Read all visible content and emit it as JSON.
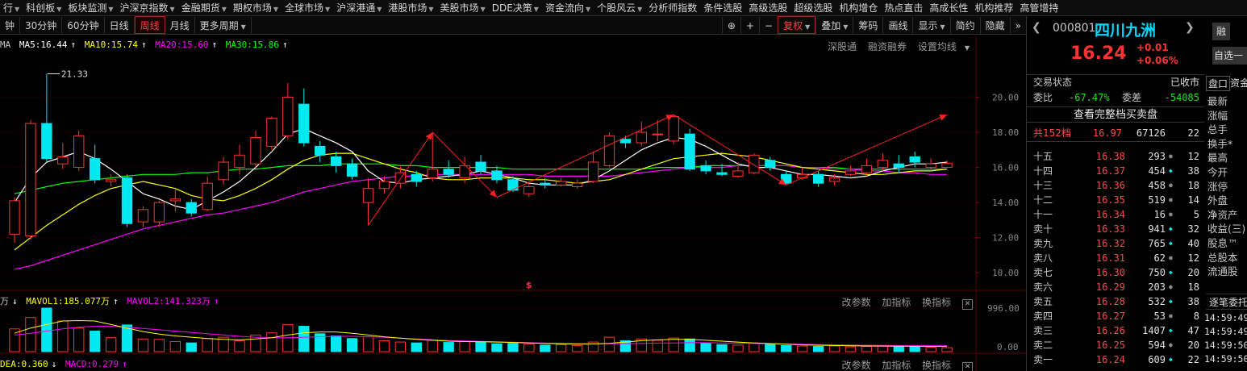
{
  "menu": [
    {
      "label": "行",
      "arrow": true
    },
    {
      "label": "科创板",
      "arrow": true
    },
    {
      "label": "板块监测",
      "arrow": true
    },
    {
      "label": "沪深京指数",
      "arrow": true
    },
    {
      "label": "金融期货",
      "arrow": true
    },
    {
      "label": "期权市场",
      "arrow": true
    },
    {
      "label": "全球市场",
      "arrow": true
    },
    {
      "label": "沪深港通",
      "arrow": true
    },
    {
      "label": "港股市场",
      "arrow": true
    },
    {
      "label": "美股市场",
      "arrow": true
    },
    {
      "label": "DDE决策",
      "arrow": true
    },
    {
      "label": "资金流向",
      "arrow": true
    },
    {
      "label": "个股风云",
      "arrow": true
    },
    {
      "label": "分析师指数",
      "arrow": false
    },
    {
      "label": "条件选股",
      "arrow": false
    },
    {
      "label": "高级选股",
      "arrow": false
    },
    {
      "label": "超级选股",
      "arrow": false
    },
    {
      "label": "机构增仓",
      "arrow": false
    },
    {
      "label": "热点直击",
      "arrow": false
    },
    {
      "label": "高成长性",
      "arrow": false
    },
    {
      "label": "机构推荐",
      "arrow": false
    },
    {
      "label": "高管增持",
      "arrow": false
    }
  ],
  "periods": [
    "钟",
    "30分钟",
    "60分钟",
    "日线",
    "周线",
    "月线",
    "更多周期"
  ],
  "active_period": "周线",
  "toolbar_right": [
    "⊕",
    "+",
    "−",
    "复权",
    "叠加",
    "筹码",
    "画线",
    "显示",
    "简约",
    "隐藏",
    "»"
  ],
  "ma_legend": {
    "prefix": "MA",
    "ma5": "MA5:16.44",
    "ma10": "MA10:15.74",
    "ma20": "MA20:15.60",
    "ma30": "MA30:15.86"
  },
  "chart_links": [
    "深股通",
    "融资融券",
    "设置均线"
  ],
  "price_axis": [
    "20.00",
    "18.00",
    "16.00",
    "14.00",
    "12.00",
    "10.00"
  ],
  "high_marker": "21.33",
  "dividend_marker": "$",
  "vol_legend": {
    "prefix": "万",
    "mavol1": "MAVOL1:185.077万",
    "mavol2": "MAVOL2:141.323万"
  },
  "vol_axis": [
    "996.00",
    "0.00"
  ],
  "indicator_links": [
    "改参数",
    "加指标",
    "换指标"
  ],
  "macd_legend": {
    "dea": "DEA:0.360",
    "macd": "MACD:0.279"
  },
  "chart_data": {
    "type": "candlestick",
    "title": "",
    "period": "周线",
    "y_axis_ticks": [
      10,
      12,
      14,
      16,
      18,
      20
    ],
    "ylim": [
      9.0,
      22.5
    ],
    "candles": [
      {
        "o": 12.2,
        "c": 14.1,
        "h": 14.3,
        "l": 11.7
      },
      {
        "o": 12.1,
        "c": 18.5,
        "h": 18.7,
        "l": 11.9
      },
      {
        "o": 18.5,
        "c": 16.5,
        "h": 21.33,
        "l": 16.3
      },
      {
        "o": 16.2,
        "c": 16.6,
        "h": 17.4,
        "l": 15.9
      },
      {
        "o": 16.0,
        "c": 17.8,
        "h": 18.1,
        "l": 15.8
      },
      {
        "o": 16.5,
        "c": 15.3,
        "h": 17.3,
        "l": 15.1
      },
      {
        "o": 15.2,
        "c": 15.3,
        "h": 15.6,
        "l": 14.9
      },
      {
        "o": 15.4,
        "c": 12.8,
        "h": 15.6,
        "l": 12.6
      },
      {
        "o": 12.9,
        "c": 13.6,
        "h": 13.8,
        "l": 12.6
      },
      {
        "o": 12.9,
        "c": 14.0,
        "h": 14.1,
        "l": 12.6
      },
      {
        "o": 14.1,
        "c": 14.2,
        "h": 14.8,
        "l": 13.5
      },
      {
        "o": 14.0,
        "c": 13.4,
        "h": 14.2,
        "l": 13.2
      },
      {
        "o": 13.6,
        "c": 15.1,
        "h": 15.5,
        "l": 13.5
      },
      {
        "o": 15.3,
        "c": 16.3,
        "h": 16.6,
        "l": 15.0
      },
      {
        "o": 16.0,
        "c": 16.7,
        "h": 17.3,
        "l": 15.6
      },
      {
        "o": 16.2,
        "c": 17.7,
        "h": 18.1,
        "l": 16.0
      },
      {
        "o": 17.2,
        "c": 18.8,
        "h": 18.9,
        "l": 17.0
      },
      {
        "o": 17.8,
        "c": 20.0,
        "h": 20.8,
        "l": 17.6
      },
      {
        "o": 19.6,
        "c": 17.4,
        "h": 20.5,
        "l": 17.2
      },
      {
        "o": 17.2,
        "c": 16.7,
        "h": 17.5,
        "l": 16.3
      },
      {
        "o": 16.6,
        "c": 16.1,
        "h": 16.9,
        "l": 15.7
      },
      {
        "o": 16.2,
        "c": 15.5,
        "h": 16.5,
        "l": 15.3
      },
      {
        "o": 14.0,
        "c": 14.8,
        "h": 15.4,
        "l": 12.7
      },
      {
        "o": 14.8,
        "c": 15.2,
        "h": 15.5,
        "l": 14.5
      },
      {
        "o": 15.1,
        "c": 15.7,
        "h": 16.1,
        "l": 14.8
      },
      {
        "o": 15.6,
        "c": 15.2,
        "h": 15.8,
        "l": 14.9
      },
      {
        "o": 15.4,
        "c": 15.9,
        "h": 18.0,
        "l": 15.2
      },
      {
        "o": 15.9,
        "c": 15.6,
        "h": 16.4,
        "l": 15.4
      },
      {
        "o": 15.4,
        "c": 16.1,
        "h": 16.6,
        "l": 15.1
      },
      {
        "o": 16.3,
        "c": 15.8,
        "h": 16.7,
        "l": 15.6
      },
      {
        "o": 15.8,
        "c": 15.3,
        "h": 16.1,
        "l": 15.1
      },
      {
        "o": 15.3,
        "c": 14.7,
        "h": 15.5,
        "l": 14.6
      },
      {
        "o": 14.5,
        "c": 14.9,
        "h": 15.2,
        "l": 14.3
      },
      {
        "o": 15.1,
        "c": 15.0,
        "h": 15.4,
        "l": 14.8
      },
      {
        "o": 15.0,
        "c": 15.2,
        "h": 15.4,
        "l": 14.9
      },
      {
        "o": 14.9,
        "c": 15.1,
        "h": 15.3,
        "l": 14.8
      },
      {
        "o": 15.2,
        "c": 16.3,
        "h": 16.9,
        "l": 15.1
      },
      {
        "o": 16.1,
        "c": 17.8,
        "h": 18.0,
        "l": 16.0
      },
      {
        "o": 17.6,
        "c": 17.4,
        "h": 17.8,
        "l": 17.1
      },
      {
        "o": 17.4,
        "c": 18.0,
        "h": 18.6,
        "l": 17.2
      },
      {
        "o": 17.9,
        "c": 17.9,
        "h": 18.7,
        "l": 17.5
      },
      {
        "o": 17.5,
        "c": 18.9,
        "h": 19.0,
        "l": 17.3
      },
      {
        "o": 17.9,
        "c": 15.9,
        "h": 18.2,
        "l": 15.8
      },
      {
        "o": 16.1,
        "c": 15.8,
        "h": 16.4,
        "l": 15.6
      },
      {
        "o": 15.7,
        "c": 15.6,
        "h": 16.2,
        "l": 15.5
      },
      {
        "o": 15.5,
        "c": 15.8,
        "h": 16.3,
        "l": 15.4
      },
      {
        "o": 15.7,
        "c": 16.7,
        "h": 16.8,
        "l": 15.6
      },
      {
        "o": 16.4,
        "c": 16.0,
        "h": 16.6,
        "l": 15.8
      },
      {
        "o": 15.6,
        "c": 15.1,
        "h": 15.8,
        "l": 15.0
      },
      {
        "o": 15.4,
        "c": 15.6,
        "h": 16.0,
        "l": 15.3
      },
      {
        "o": 15.6,
        "c": 15.1,
        "h": 15.8,
        "l": 14.9
      },
      {
        "o": 15.2,
        "c": 15.4,
        "h": 15.6,
        "l": 15.0
      },
      {
        "o": 15.6,
        "c": 15.8,
        "h": 16.1,
        "l": 15.5
      },
      {
        "o": 15.7,
        "c": 16.1,
        "h": 16.5,
        "l": 15.5
      },
      {
        "o": 16.0,
        "c": 16.4,
        "h": 16.8,
        "l": 15.8
      },
      {
        "o": 16.2,
        "c": 16.0,
        "h": 16.7,
        "l": 15.7
      },
      {
        "o": 16.6,
        "c": 16.3,
        "h": 16.9,
        "l": 16.0
      },
      {
        "o": 16.0,
        "c": 16.2,
        "h": 16.5,
        "l": 15.9
      },
      {
        "o": 16.0,
        "c": 16.24,
        "h": 16.4,
        "l": 16.0
      }
    ],
    "ma5": [
      14.0,
      15.4,
      16.3,
      16.6,
      16.9,
      16.5,
      15.9,
      15.2,
      14.5,
      14.2,
      13.8,
      13.6,
      14.1,
      14.6,
      15.2,
      16.0,
      16.9,
      17.9,
      18.2,
      17.8,
      17.4,
      16.9,
      15.8,
      15.2,
      15.1,
      15.3,
      15.4,
      15.5,
      15.6,
      15.8,
      15.6,
      15.4,
      15.1,
      15.0,
      15.0,
      15.0,
      15.3,
      15.8,
      16.4,
      17.0,
      17.4,
      17.7,
      17.6,
      17.2,
      16.7,
      16.2,
      16.0,
      16.0,
      15.8,
      15.6,
      15.6,
      15.5,
      15.4,
      15.5,
      15.8,
      16.0,
      16.2,
      16.2,
      16.3
    ],
    "ma10": [
      11.3,
      12.0,
      12.7,
      13.3,
      13.9,
      14.4,
      14.8,
      15.0,
      15.2,
      15.0,
      14.8,
      14.4,
      14.2,
      14.1,
      14.4,
      14.8,
      15.3,
      15.9,
      16.4,
      16.7,
      16.8,
      16.8,
      16.5,
      16.2,
      15.9,
      15.7,
      15.4,
      15.3,
      15.3,
      15.4,
      15.4,
      15.4,
      15.3,
      15.3,
      15.2,
      15.1,
      15.2,
      15.3,
      15.6,
      15.9,
      16.2,
      16.5,
      16.6,
      16.7,
      16.8,
      16.7,
      16.6,
      16.4,
      16.2,
      16.0,
      15.9,
      15.8,
      15.7,
      15.6,
      15.6,
      15.7,
      15.8,
      15.8,
      15.9
    ],
    "ma20": [
      10.2,
      10.4,
      10.7,
      11.0,
      11.3,
      11.6,
      11.9,
      12.2,
      12.5,
      12.7,
      12.9,
      13.1,
      13.3,
      13.4,
      13.6,
      13.8,
      14.0,
      14.3,
      14.6,
      14.8,
      15.0,
      15.2,
      15.3,
      15.4,
      15.5,
      15.5,
      15.6,
      15.6,
      15.6,
      15.6,
      15.6,
      15.6,
      15.6,
      15.5,
      15.5,
      15.5,
      15.5,
      15.5,
      15.6,
      15.7,
      15.8,
      15.9,
      16.0,
      16.0,
      16.0,
      16.1,
      16.1,
      16.1,
      16.1,
      16.0,
      16.0,
      15.9,
      15.9,
      15.8,
      15.8,
      15.7,
      15.7,
      15.6,
      15.6
    ],
    "ma30": [
      14.5,
      14.7,
      14.9,
      15.1,
      15.2,
      15.3,
      15.4,
      15.5,
      15.6,
      15.6,
      15.6,
      15.7,
      15.7,
      15.8,
      15.9,
      15.9,
      16.0,
      16.1,
      16.1,
      16.1,
      16.2,
      16.2,
      16.2,
      16.2,
      16.1,
      16.1,
      16.0,
      16.0,
      16.0,
      16.0,
      16.0,
      15.9,
      15.9,
      15.9,
      15.9,
      15.9,
      15.9,
      15.9,
      15.9,
      15.9,
      16.0,
      16.0,
      16.0,
      16.1,
      16.1,
      16.1,
      16.1,
      16.1,
      16.1,
      16.0,
      16.0,
      16.0,
      15.9,
      15.9,
      15.9,
      15.9,
      15.9,
      15.9,
      15.9
    ],
    "volume": [
      520,
      780,
      996,
      700,
      540,
      470,
      320,
      610,
      290,
      280,
      230,
      200,
      300,
      330,
      250,
      380,
      430,
      620,
      580,
      410,
      360,
      300,
      340,
      250,
      220,
      200,
      260,
      210,
      240,
      230,
      180,
      190,
      170,
      150,
      160,
      140,
      220,
      330,
      250,
      290,
      260,
      310,
      290,
      200,
      160,
      150,
      200,
      170,
      140,
      130,
      120,
      130,
      110,
      120,
      130,
      110,
      120,
      100,
      90
    ],
    "volume_axis": [
      0,
      996
    ],
    "mavol1": [
      420,
      540,
      620,
      700,
      710,
      700,
      620,
      540,
      460,
      400,
      360,
      330,
      300,
      280,
      270,
      290,
      320,
      380,
      430,
      450,
      450,
      420,
      380,
      340,
      310,
      280,
      260,
      240,
      230,
      225,
      220,
      210,
      200,
      190,
      180,
      170,
      175,
      190,
      220,
      250,
      270,
      280,
      280,
      260,
      240,
      220,
      200,
      185,
      170,
      155,
      145,
      140,
      135,
      130,
      128,
      125,
      122,
      120,
      118
    ],
    "mavol2": [
      380,
      420,
      470,
      520,
      560,
      580,
      580,
      560,
      530,
      500,
      470,
      440,
      410,
      380,
      350,
      330,
      320,
      320,
      330,
      340,
      350,
      350,
      340,
      330,
      310,
      290,
      270,
      255,
      245,
      235,
      225,
      215,
      205,
      195,
      190,
      185,
      182,
      182,
      185,
      190,
      195,
      200,
      205,
      205,
      200,
      195,
      190,
      182,
      175,
      168,
      160,
      155,
      150,
      146,
      143,
      141,
      141,
      141,
      141
    ]
  },
  "quote": {
    "code": "000801",
    "name": "四川九洲",
    "side_buttons": [
      "融",
      "自选"
    ],
    "price": "16.24",
    "change": "+0.01",
    "change_pct": "+0.06%",
    "status_label": "交易状态",
    "status_value": "已收市",
    "weibi_label": "委比",
    "weibi_value": "-67.47%",
    "weicha_label": "委差",
    "weicha_value": "-54085",
    "view_full": "查看完整档买卖盘",
    "total_label": "共152档",
    "total_price": "16.97",
    "total_vol": "67126",
    "total_count": "22"
  },
  "orderbook": [
    {
      "label": "十五",
      "price": "16.38",
      "vol": "293",
      "count": "12",
      "mark": "dot"
    },
    {
      "label": "十四",
      "price": "16.37",
      "vol": "454",
      "count": "38",
      "mark": "diamond"
    },
    {
      "label": "十三",
      "price": "16.36",
      "vol": "458",
      "count": "18",
      "mark": "dot"
    },
    {
      "label": "十二",
      "price": "16.35",
      "vol": "519",
      "count": "14",
      "mark": "dot"
    },
    {
      "label": "十一",
      "price": "16.34",
      "vol": "16",
      "count": "5",
      "mark": "dot"
    },
    {
      "label": "卖十",
      "price": "16.33",
      "vol": "941",
      "count": "32",
      "mark": "diamond"
    },
    {
      "label": "卖九",
      "price": "16.32",
      "vol": "765",
      "count": "40",
      "mark": "diamond"
    },
    {
      "label": "卖八",
      "price": "16.31",
      "vol": "62",
      "count": "12",
      "mark": "dot"
    },
    {
      "label": "卖七",
      "price": "16.30",
      "vol": "750",
      "count": "20",
      "mark": "diamond"
    },
    {
      "label": "卖六",
      "price": "16.29",
      "vol": "203",
      "count": "18",
      "mark": "dot"
    },
    {
      "label": "卖五",
      "price": "16.28",
      "vol": "532",
      "count": "38",
      "mark": "diamond"
    },
    {
      "label": "卖四",
      "price": "16.27",
      "vol": "53",
      "count": "8",
      "mark": "dot"
    },
    {
      "label": "卖三",
      "price": "16.26",
      "vol": "1407",
      "count": "47",
      "mark": "diamond"
    },
    {
      "label": "卖二",
      "price": "16.25",
      "vol": "594",
      "count": "20",
      "mark": "dot"
    },
    {
      "label": "卖一",
      "price": "16.24",
      "vol": "609",
      "count": "22",
      "mark": "diamond"
    }
  ],
  "side_tabs": [
    "盘口",
    "资金"
  ],
  "side_list": [
    "最新",
    "涨幅",
    "总手",
    "换手*",
    "最高",
    "今开",
    "涨停",
    "外盘",
    "净资产",
    "收益(三)",
    "股息™",
    "总股本",
    "流通股"
  ],
  "ticks_header": "逐笔委托",
  "tick_times": [
    "14:59:49",
    "14:59:49",
    "14:59:50",
    "14:59:50"
  ],
  "colors": {
    "up": "#ff3232",
    "down": "#00e8f0",
    "ma5": "#ffffff",
    "ma10": "#ffff00",
    "ma20": "#ff00ff",
    "ma30": "#00ff00",
    "arrow": "#ff2020",
    "grid": "#3a0000",
    "axis_text": "#8a8a8a",
    "name": "#00d8ff"
  }
}
